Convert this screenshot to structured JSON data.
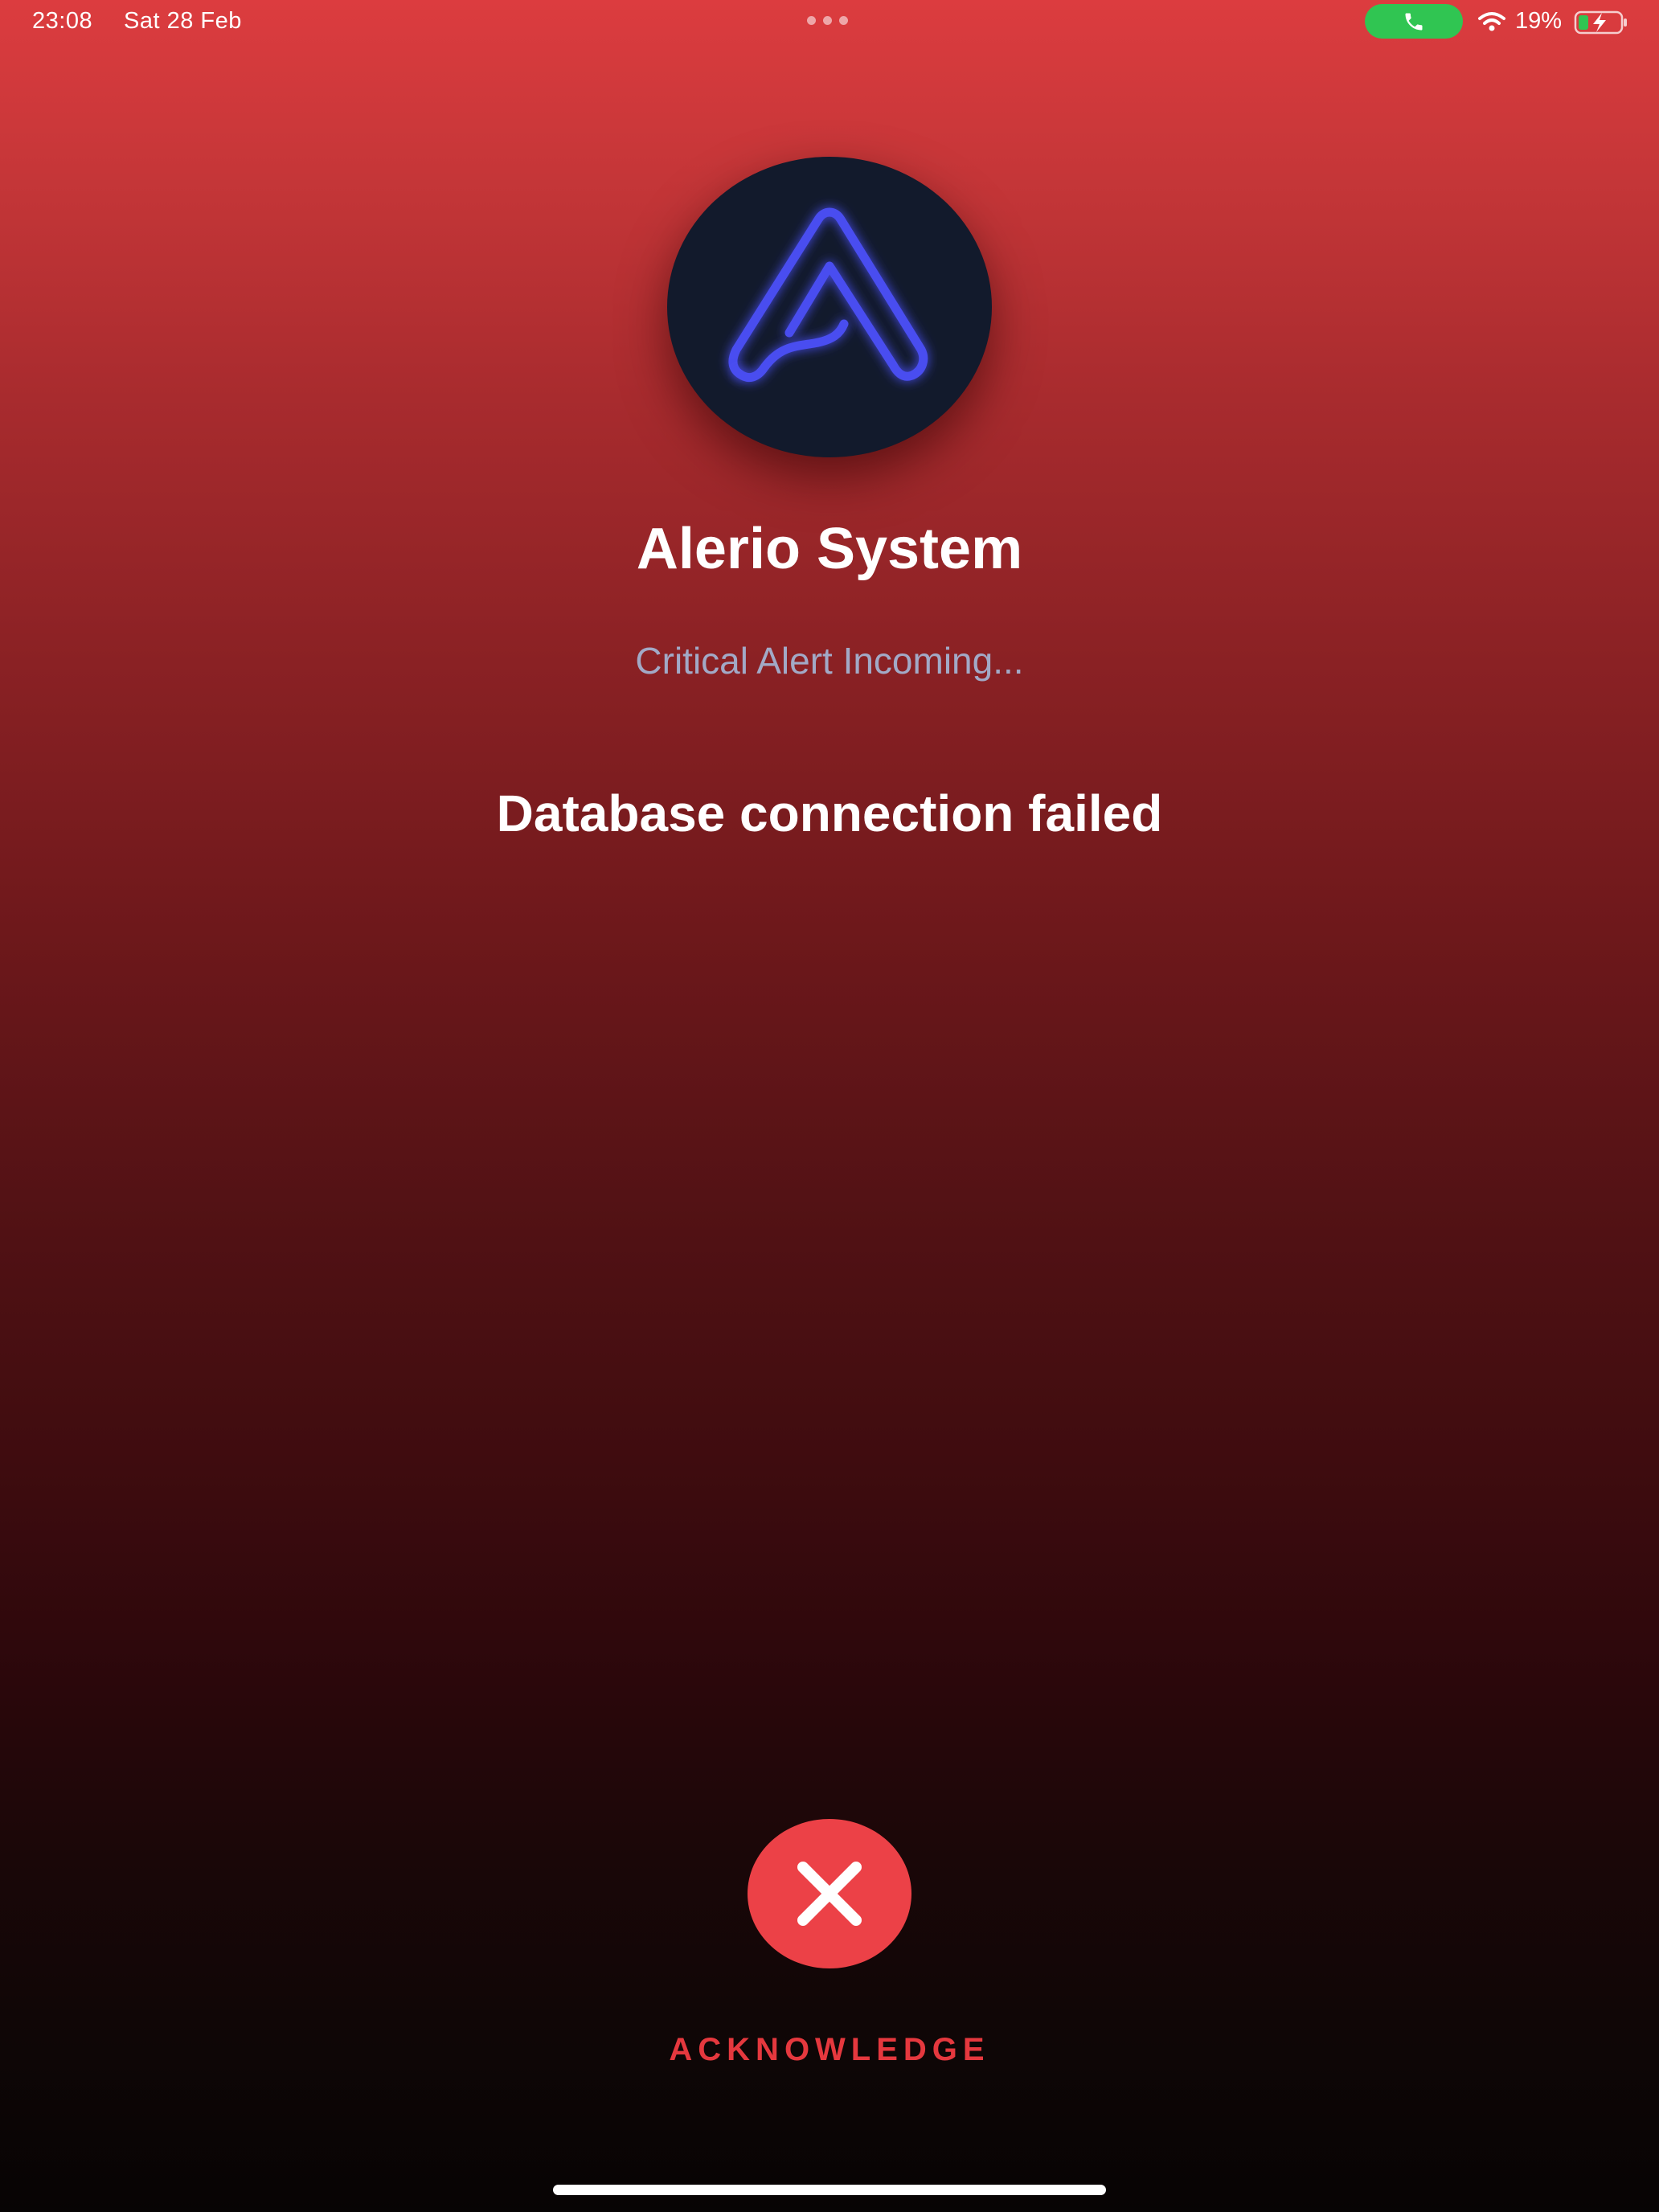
{
  "status_bar": {
    "time": "23:08",
    "date": "Sat 28 Feb",
    "battery_percent": "19%",
    "call_indicator_color": "#30c552",
    "icons": [
      "phone-icon",
      "wifi-icon",
      "battery-charging-icon"
    ]
  },
  "caller": {
    "app_name": "Alerio System",
    "status": "Critical Alert Incoming...",
    "message": "Database connection failed",
    "logo_icon": "alerio-logo-icon",
    "logo_color": "#4a4ef0"
  },
  "actions": {
    "acknowledge_label": "ACKNOWLEDGE",
    "acknowledge_icon": "close-icon",
    "acknowledge_color": "#ec4147"
  },
  "theme": {
    "background_top": "#dc3c3f",
    "background_bottom": "#070404"
  }
}
